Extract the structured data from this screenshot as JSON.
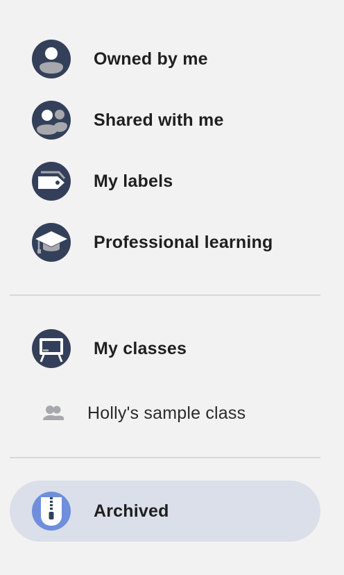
{
  "nav": {
    "owned": {
      "label": "Owned by me",
      "icon": "person-icon"
    },
    "shared": {
      "label": "Shared with me",
      "icon": "people-icon"
    },
    "labels": {
      "label": "My labels",
      "icon": "label-tag-icon"
    },
    "learning": {
      "label": "Professional learning",
      "icon": "graduation-cap-icon"
    },
    "classes": {
      "label": "My classes",
      "icon": "classroom-board-icon"
    },
    "class_item": {
      "label": "Holly's sample class",
      "icon": "group-icon"
    },
    "archived": {
      "label": "Archived",
      "icon": "archive-zipper-icon"
    }
  },
  "colors": {
    "icon_dark": "#34405a",
    "icon_light": "#a6a8ad",
    "background": "#f2f2f2",
    "active_bg": "#dadfe9",
    "archive_accent": "#6f8fdc",
    "divider": "#d8d8d8"
  }
}
